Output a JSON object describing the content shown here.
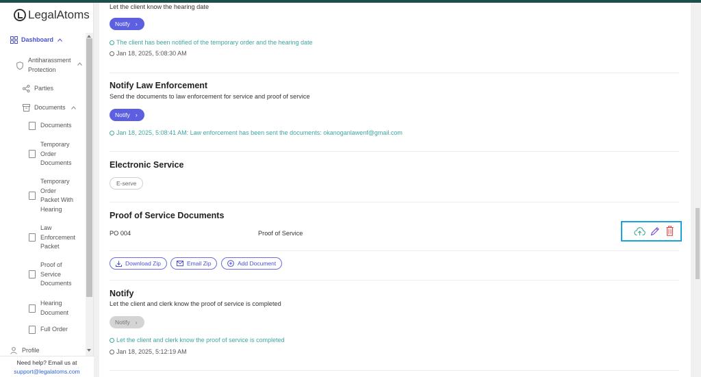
{
  "brand": {
    "logo_text": "LegalAtoms"
  },
  "sidebar": {
    "dashboard": "Dashboard",
    "antiharassment_line1": "Antiharassment",
    "antiharassment_line2": "Protection",
    "parties": "Parties",
    "documents_group": "Documents",
    "items": [
      {
        "lines": [
          "Documents"
        ]
      },
      {
        "lines": [
          "Temporary",
          "Order",
          "Documents"
        ]
      },
      {
        "lines": [
          "Temporary",
          "Order",
          "Packet With",
          "Hearing"
        ]
      },
      {
        "lines": [
          "Law",
          "Enforcement",
          "Packet"
        ]
      },
      {
        "lines": [
          "Proof of",
          "Service",
          "Documents"
        ]
      },
      {
        "lines": [
          "Hearing",
          "Document"
        ]
      },
      {
        "lines": [
          "Full Order"
        ]
      }
    ],
    "profile": "Profile",
    "help_text": "Need help? Email us at",
    "help_email": "support@legalatoms.com"
  },
  "main": {
    "top": {
      "desc": "Let the client know the hearing date",
      "notify_label": "Notify",
      "status": "The client has been notified of the temporary order and the hearing date",
      "timestamp": "Jan 18, 2025, 5:08:30 AM"
    },
    "law": {
      "title": "Notify Law Enforcement",
      "desc": "Send the documents to law enforcement for service and proof of service",
      "notify_label": "Notify",
      "status": "Jan 18, 2025, 5:08:41 AM: Law enforcement has been sent the documents: okanoganlawenf@gmail.com"
    },
    "eservice": {
      "title": "Electronic Service",
      "chip": "E-serve"
    },
    "proof": {
      "title": "Proof of Service Documents",
      "rows": [
        {
          "code": "PO 004",
          "name": "Proof of Service"
        }
      ],
      "download_zip": "Download Zip",
      "email_zip": "Email Zip",
      "add_document": "Add Document"
    },
    "notify": {
      "title": "Notify",
      "desc": "Let the client and clerk know the proof of service is completed",
      "notify_label": "Notify",
      "status": "Let the client and clerk know the proof of service is completed",
      "timestamp": "Jan 18, 2025, 5:12:19 AM"
    }
  },
  "colors": {
    "accent": "#5b5fe0",
    "teal": "#3ea6a0",
    "delete": "#e04444",
    "highlight": "#19a3dd"
  }
}
